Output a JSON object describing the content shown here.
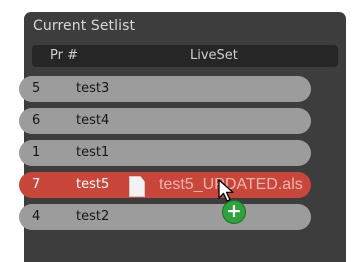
{
  "panel": {
    "title": "Current Setlist",
    "columns": {
      "pr": "Pr #",
      "liveset": "LiveSet"
    }
  },
  "rows": [
    {
      "pr": "5",
      "name": "test3",
      "selected": false
    },
    {
      "pr": "6",
      "name": "test4",
      "selected": false
    },
    {
      "pr": "1",
      "name": "test1",
      "selected": false
    },
    {
      "pr": "7",
      "name": "test5",
      "selected": true
    },
    {
      "pr": "4",
      "name": "test2",
      "selected": false
    }
  ],
  "drag": {
    "file_label": "test5_UPDATED.als",
    "file_icon": "document-icon",
    "cursor_icon": "arrow-cursor-icon",
    "badge_icon": "plus-badge-icon",
    "badge_symbol": "+"
  },
  "colors": {
    "panel_bg": "#3d3d3d",
    "row_bg": "#9c9c9c",
    "selected_row_bg": "#c9463b",
    "badge_green": "#2ea33b"
  }
}
